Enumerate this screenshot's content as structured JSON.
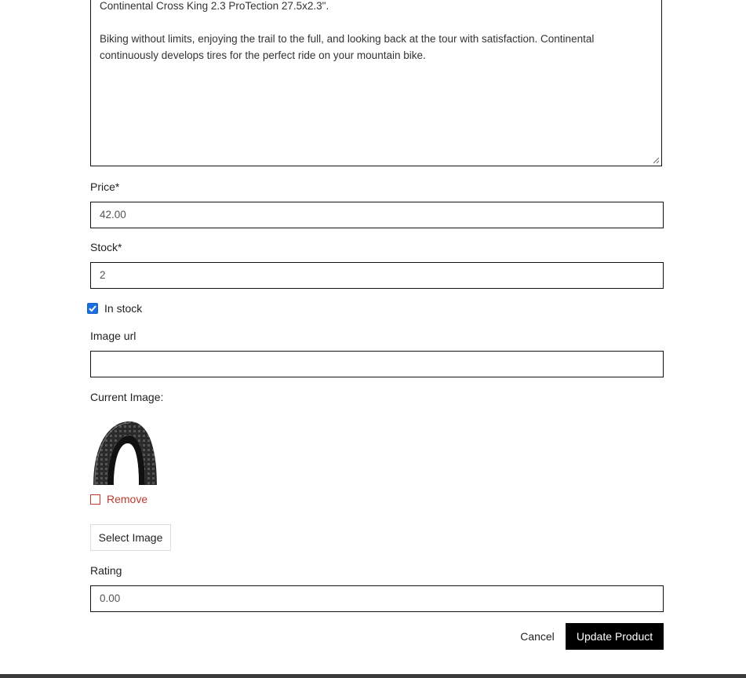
{
  "form": {
    "description": {
      "text": "Continental Cross King 2.3 ProTection 27.5x2.3\".\n\nBiking without limits, enjoying the trail to the full, and looking back at the tour with satisfaction. Continental continuously develops tires for the perfect ride on your mountain bike."
    },
    "price": {
      "label": "Price*",
      "value": "42.00"
    },
    "stock": {
      "label": "Stock*",
      "value": "2"
    },
    "in_stock": {
      "label": "In stock",
      "checked": true
    },
    "image_url": {
      "label": "Image url",
      "value": ""
    },
    "current_image": {
      "label": "Current Image:",
      "remove_label": "Remove"
    },
    "select_image_label": "Select Image",
    "rating": {
      "label": "Rating",
      "value": "0.00"
    },
    "actions": {
      "cancel_label": "Cancel",
      "update_label": "Update Product"
    }
  },
  "colors": {
    "checkbox_checked": "#1a6fe0",
    "remove_red": "#c0392b",
    "primary_button": "#000000"
  }
}
